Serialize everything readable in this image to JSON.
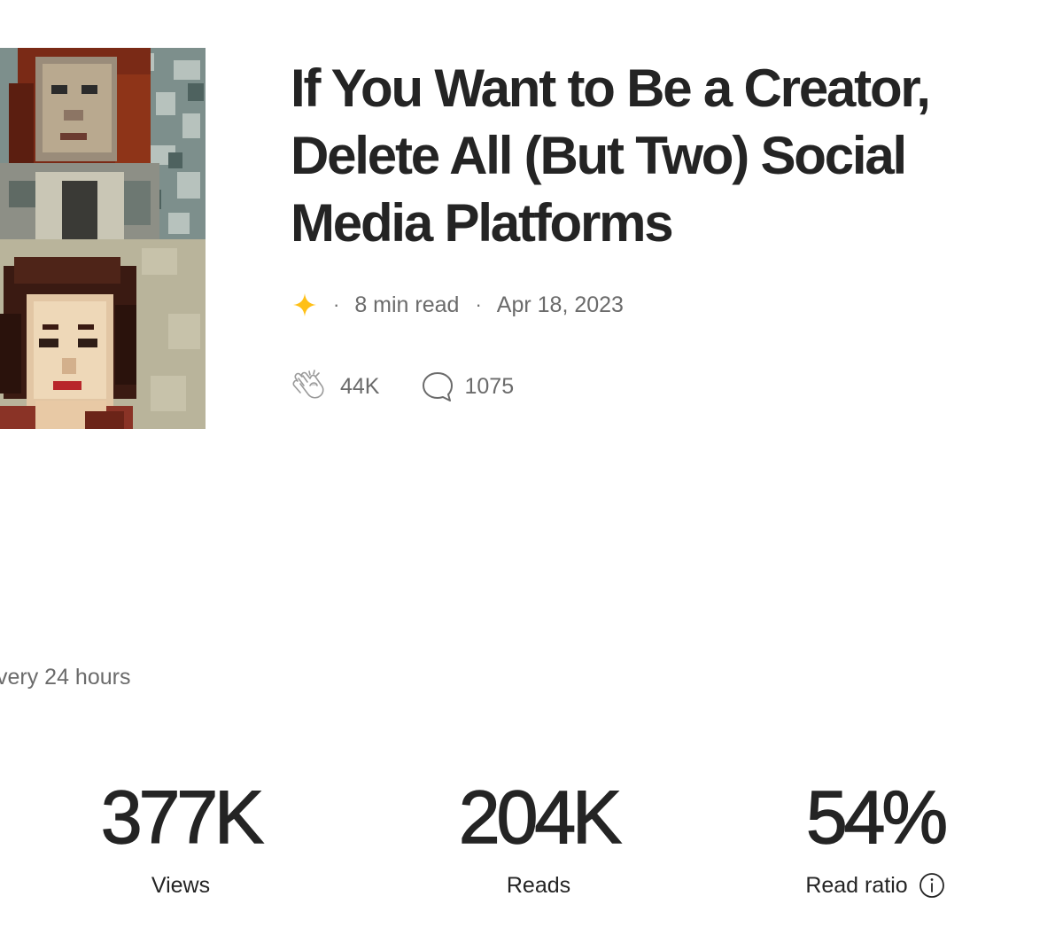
{
  "story": {
    "title": "If You Want to Be a Creator, Delete All (But Two) Social Media Platforms",
    "cover_image": "pixel-art-portraits",
    "member_only_icon": "sparkle-icon",
    "read_time": "8 min read",
    "separator": "·",
    "published_date": "Apr 18, 2023",
    "claps": "44K",
    "comments": "1075"
  },
  "stats": {
    "refresh_note": "very 24 hours",
    "views": {
      "value": "377K",
      "label": "Views"
    },
    "reads": {
      "value": "204K",
      "label": "Reads"
    },
    "read_ratio": {
      "value": "54%",
      "label": "Read ratio",
      "info_icon": "info-icon"
    }
  },
  "colors": {
    "text": "#242424",
    "muted": "#6b6b6b",
    "star": "#FFC017"
  }
}
